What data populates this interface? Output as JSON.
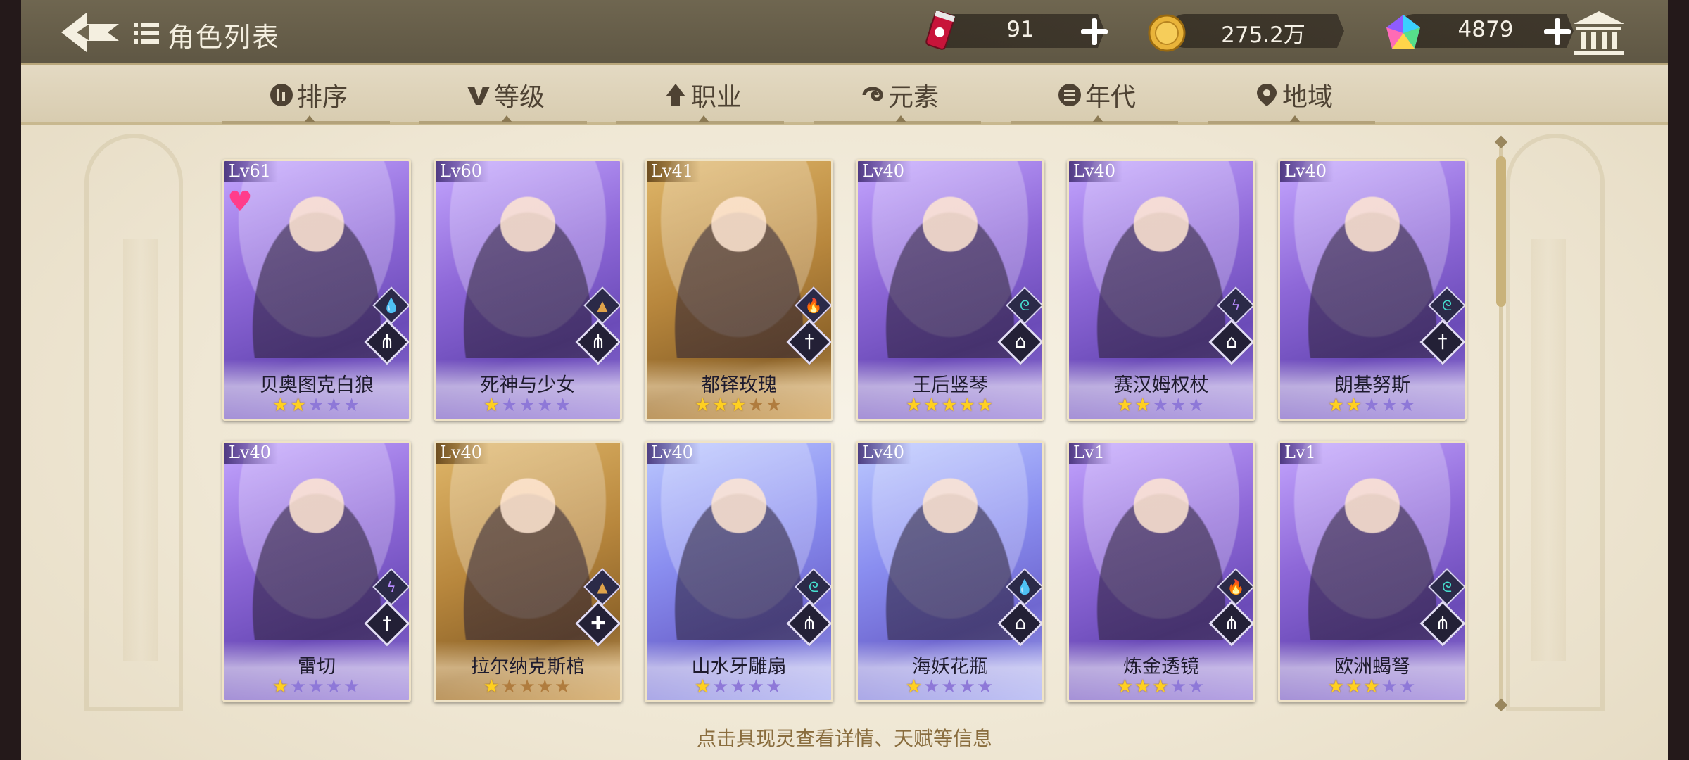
{
  "header": {
    "title": "角色列表",
    "currencies": [
      {
        "icon": "energy-drink-icon",
        "value": "91"
      },
      {
        "icon": "gold-coin-icon",
        "value": "275.2万"
      },
      {
        "icon": "rainbow-gem-icon",
        "value": "4879"
      }
    ]
  },
  "tabs": [
    {
      "label": "排序",
      "icon": "sort-icon"
    },
    {
      "label": "等级",
      "icon": "level-icon"
    },
    {
      "label": "职业",
      "icon": "class-icon"
    },
    {
      "label": "元素",
      "icon": "element-icon"
    },
    {
      "label": "年代",
      "icon": "era-icon"
    },
    {
      "label": "地域",
      "icon": "location-icon"
    }
  ],
  "cards": [
    {
      "level": "Lv61",
      "name": "贝奥图克白狼",
      "stars": 2,
      "max_stars": 5,
      "rarity": "purple",
      "element": "water-drop-icon",
      "job": "claw-class-icon",
      "favorite": true
    },
    {
      "level": "Lv60",
      "name": "死神与少女",
      "stars": 1,
      "max_stars": 5,
      "rarity": "purple",
      "element": "earth-mountain-icon",
      "job": "claw-class-icon",
      "favorite": false
    },
    {
      "level": "Lv41",
      "name": "都铎玫瑰",
      "stars": 3,
      "max_stars": 5,
      "rarity": "gold",
      "element": "fire-icon",
      "job": "sword-class-icon",
      "favorite": false
    },
    {
      "level": "Lv40",
      "name": "王后竖琴",
      "stars": 5,
      "max_stars": 5,
      "rarity": "purple",
      "element": "wind-swirl-icon",
      "job": "book-class-icon",
      "favorite": false
    },
    {
      "level": "Lv40",
      "name": "赛汉姆权杖",
      "stars": 2,
      "max_stars": 5,
      "rarity": "purple",
      "element": "lightning-icon",
      "job": "book-class-icon",
      "favorite": false
    },
    {
      "level": "Lv40",
      "name": "朗基努斯",
      "stars": 2,
      "max_stars": 5,
      "rarity": "purple",
      "element": "wind-swirl-icon",
      "job": "sword-class-icon",
      "favorite": false
    },
    {
      "level": "Lv40",
      "name": "雷切",
      "stars": 1,
      "max_stars": 5,
      "rarity": "purple",
      "element": "lightning-icon",
      "job": "sword-class-icon",
      "favorite": false
    },
    {
      "level": "Lv40",
      "name": "拉尔纳克斯棺",
      "stars": 1,
      "max_stars": 5,
      "rarity": "gold",
      "element": "earth-mountain-icon",
      "job": "cross-class-icon",
      "favorite": false
    },
    {
      "level": "Lv40",
      "name": "山水牙雕扇",
      "stars": 1,
      "max_stars": 5,
      "rarity": "blue",
      "element": "wind-swirl-icon",
      "job": "claw-class-icon",
      "favorite": false
    },
    {
      "level": "Lv40",
      "name": "海妖花瓶",
      "stars": 1,
      "max_stars": 5,
      "rarity": "blue",
      "element": "water-drop-icon",
      "job": "book-class-icon",
      "favorite": false
    },
    {
      "level": "Lv1",
      "name": "炼金透镜",
      "stars": 3,
      "max_stars": 5,
      "rarity": "purple",
      "element": "fire-icon",
      "job": "claw-class-icon",
      "favorite": false
    },
    {
      "level": "Lv1",
      "name": "欧洲蝎弩",
      "stars": 3,
      "max_stars": 5,
      "rarity": "purple",
      "element": "wind-swirl-icon",
      "job": "claw-class-icon",
      "favorite": false
    }
  ],
  "hint": "点击具现灵查看详情、天赋等信息",
  "colors": {
    "header_bg": "#6f6650",
    "tab_bar_bg": "#e4dac3",
    "star_on": "#ffd020",
    "hint_text": "#8a6d3e"
  }
}
